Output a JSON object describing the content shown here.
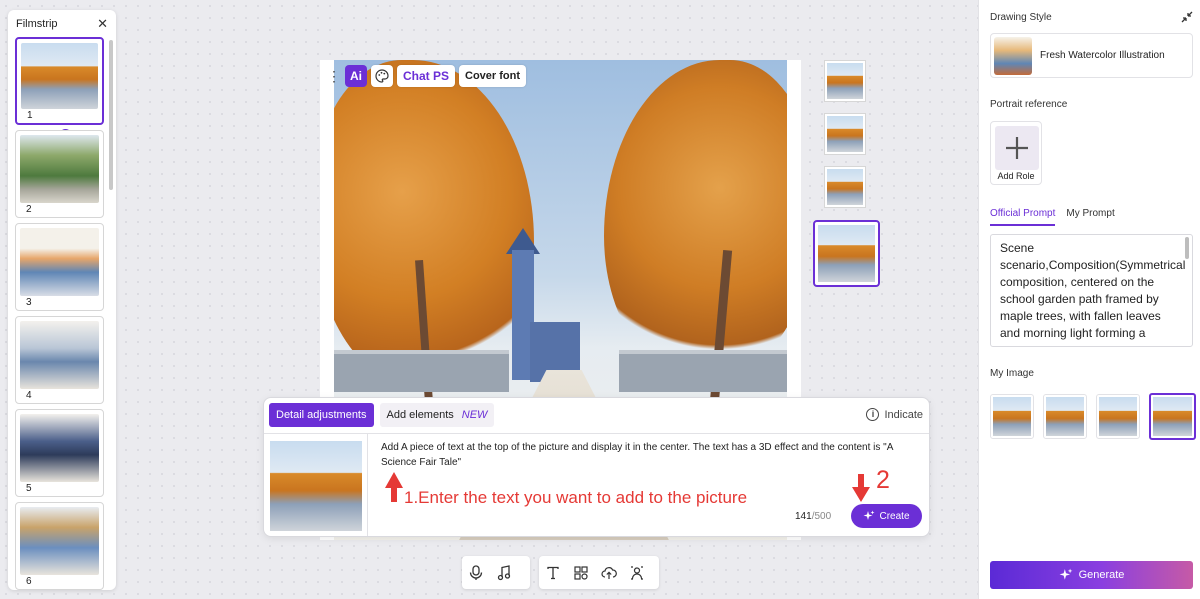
{
  "filmstrip": {
    "title": "Filmstrip",
    "close_icon": "close-icon",
    "pages": [
      {
        "num": "1",
        "image": "autumn-path"
      },
      {
        "num": "2",
        "image": "green-path"
      },
      {
        "num": "3",
        "image": "two-kids-table"
      },
      {
        "num": "4",
        "image": "girl-at-desk"
      },
      {
        "num": "5",
        "image": "girl-and-boy"
      },
      {
        "num": "6",
        "image": "boy-with-machine"
      }
    ],
    "selected_page": "1"
  },
  "canvas_toolbar": {
    "ai_label": "Ai",
    "chat_ps_label": "Chat PS",
    "cover_font_label": "Cover font"
  },
  "edit_panel": {
    "tab_detail": "Detail adjustments",
    "tab_add_elements": "Add elements",
    "new_badge": "NEW",
    "indicate_label": "Indicate",
    "prompt_text": "Add A piece of text at the top of the picture and display it in the center. The text has a 3D effect and the content is \"A Science Fair Tale\"",
    "annotation_1": "1.Enter the text you want to add to the picture",
    "annotation_2": "2",
    "char_count": "141",
    "char_limit": "/500",
    "create_label": "Create"
  },
  "bottom_toolbar": {
    "group1": [
      "microphone-icon",
      "music-icon"
    ],
    "group2": [
      "text-icon",
      "elements-icon",
      "upload-icon",
      "background-remove-icon"
    ]
  },
  "right_panel": {
    "drawing_style_label": "Drawing Style",
    "style_name": "Fresh Watercolor Illustration",
    "portrait_reference_label": "Portrait reference",
    "add_role_label": "Add Role",
    "tab_official": "Official Prompt",
    "tab_my": "My Prompt",
    "prompt_text": "Scene scenario,Composition(Symmetrical composition, centered on the school garden path framed by maple trees, with fallen leaves and morning light forming a",
    "my_image_label": "My Image",
    "generate_label": "Generate"
  },
  "colors": {
    "accent": "#6b2fd6",
    "annotation_red": "#e53935"
  }
}
